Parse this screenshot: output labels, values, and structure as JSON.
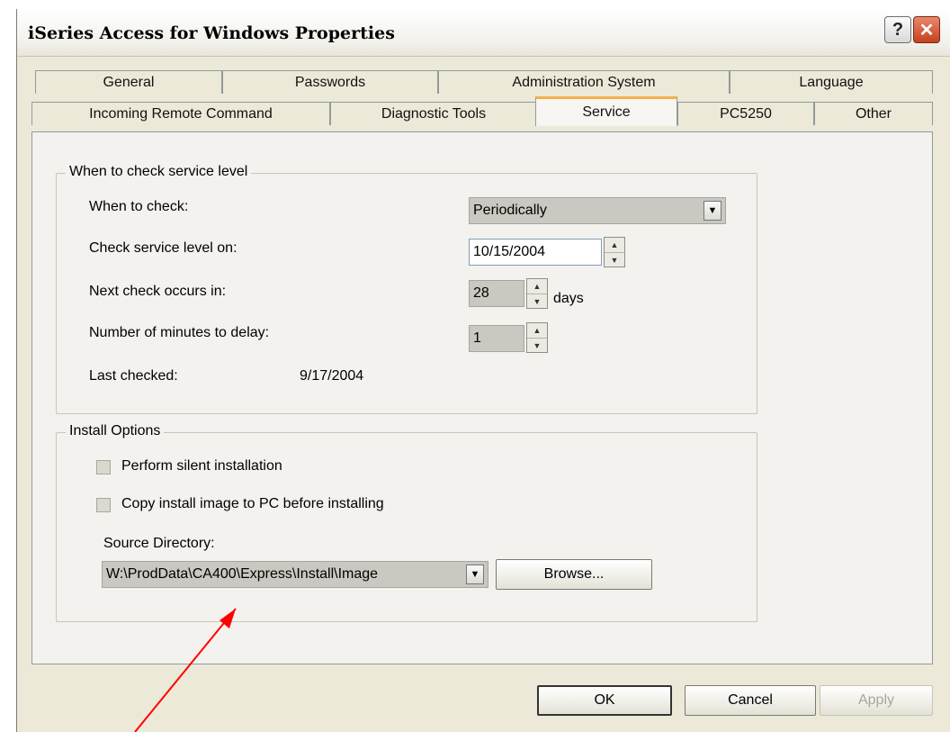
{
  "window": {
    "title": "iSeries Access for Windows Properties"
  },
  "tabs_row1": [
    "General",
    "Passwords",
    "Administration System",
    "Language"
  ],
  "tabs_row2": [
    "Incoming Remote Command",
    "Diagnostic Tools",
    "Service",
    "PC5250",
    "Other"
  ],
  "active_tab": "Service",
  "service_level": {
    "group_title": "When to check service level",
    "when_label": "When to check:",
    "when_value": "Periodically",
    "check_on_label": "Check service level on:",
    "check_on_value": "10/15/2004",
    "next_label": "Next check occurs in:",
    "next_value": "28",
    "next_unit": "days",
    "delay_label": "Number of minutes to delay:",
    "delay_value": "1",
    "last_label": "Last checked:",
    "last_value": "9/17/2004"
  },
  "install": {
    "group_title": "Install Options",
    "silent_label": "Perform silent installation",
    "copy_label": "Copy install image to PC before installing",
    "source_label": "Source Directory:",
    "source_value": "W:\\ProdData\\CA400\\Express\\Install\\Image",
    "browse_label": "Browse..."
  },
  "buttons": {
    "ok": "OK",
    "cancel": "Cancel",
    "apply": "Apply"
  },
  "annotation": {
    "arrow_color": "#ff0000"
  }
}
